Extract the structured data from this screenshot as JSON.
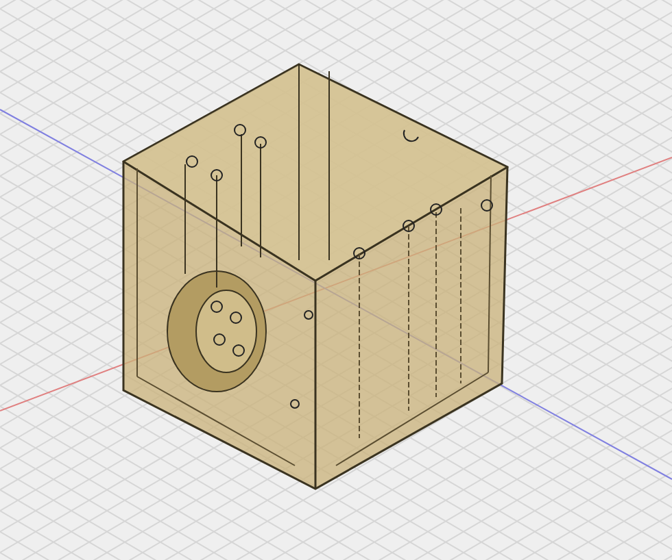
{
  "viewport": {
    "model": {
      "kind": "box"
    },
    "grid": true
  }
}
